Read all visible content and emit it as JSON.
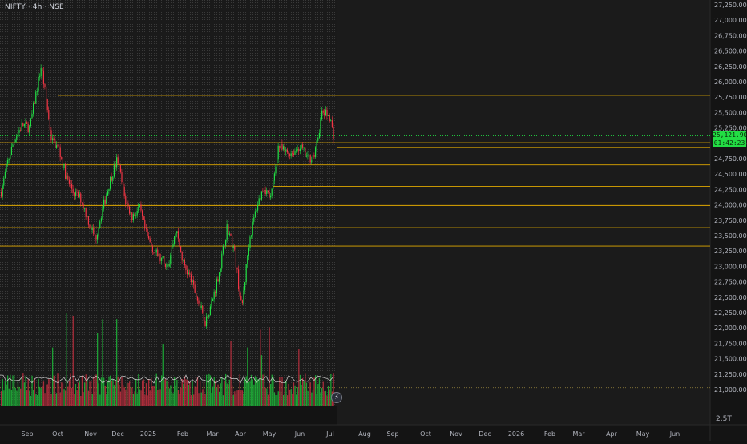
{
  "header": {
    "symbol": "NIFTY",
    "interval": "4h",
    "exchange": "NSE",
    "title": "NIFTY · 4h · NSE"
  },
  "price_axis": {
    "labels": [
      "27,250.00",
      "27,000.00",
      "26,750.00",
      "26,500.00",
      "26,250.00",
      "26,000.00",
      "25,750.00",
      "25,500.00",
      "25,250.00",
      "25,000.00",
      "24,750.00",
      "24,500.00",
      "24,250.00",
      "24,000.00",
      "23,750.00",
      "23,500.00",
      "23,250.00",
      "23,000.00",
      "22,750.00",
      "22,500.00",
      "22,250.00",
      "22,000.00",
      "21,750.00",
      "21,500.00",
      "21,250.00",
      "21,000.00"
    ],
    "volume_label": "2.5T"
  },
  "time_axis": {
    "labels": [
      "Sep",
      "Oct",
      "Nov",
      "Dec",
      "2025",
      "Feb",
      "Mar",
      "Apr",
      "May",
      "Jun",
      "Jul",
      "Aug",
      "Sep",
      "Oct",
      "Nov",
      "Dec",
      "2026",
      "Feb",
      "Mar",
      "Apr",
      "May",
      "Jun"
    ]
  },
  "last_price": {
    "price": "25,121.90",
    "countdown": "01:42:23"
  },
  "colors": {
    "background": "#131313",
    "up": "#22dd44",
    "down": "#f23645",
    "level_line": "#e0a800",
    "text": "#d1d4dc"
  },
  "icons": {
    "replay": "lightning-icon"
  },
  "chart_data": {
    "type": "candlestick",
    "title": "NIFTY · 4h · NSE",
    "x_range": [
      "2024-08-19",
      "2026-06-30"
    ],
    "ylim": [
      20800,
      27400
    ],
    "y_scale": "linear",
    "grid": false,
    "legend": "none",
    "close_path": [
      [
        "2024-08-19",
        24150
      ],
      [
        "2024-08-26",
        24700
      ],
      [
        "2024-09-02",
        25100
      ],
      [
        "2024-09-09",
        25300
      ],
      [
        "2024-09-16",
        25250
      ],
      [
        "2024-09-23",
        25900
      ],
      [
        "2024-09-27",
        26250
      ],
      [
        "2024-10-01",
        25800
      ],
      [
        "2024-10-07",
        25050
      ],
      [
        "2024-10-14",
        24900
      ],
      [
        "2024-10-21",
        24450
      ],
      [
        "2024-10-28",
        24200
      ],
      [
        "2024-11-04",
        24100
      ],
      [
        "2024-11-11",
        23750
      ],
      [
        "2024-11-18",
        23450
      ],
      [
        "2024-11-25",
        23950
      ],
      [
        "2024-12-02",
        24400
      ],
      [
        "2024-12-09",
        24750
      ],
      [
        "2024-12-16",
        24100
      ],
      [
        "2024-12-23",
        23800
      ],
      [
        "2024-12-30",
        23950
      ],
      [
        "2025-01-06",
        23500
      ],
      [
        "2025-01-13",
        23250
      ],
      [
        "2025-01-20",
        23100
      ],
      [
        "2025-01-27",
        23050
      ],
      [
        "2025-02-03",
        23600
      ],
      [
        "2025-02-10",
        23050
      ],
      [
        "2025-02-17",
        22800
      ],
      [
        "2025-02-24",
        22450
      ],
      [
        "2025-03-03",
        22100
      ],
      [
        "2025-03-10",
        22450
      ],
      [
        "2025-03-17",
        22950
      ],
      [
        "2025-03-24",
        23650
      ],
      [
        "2025-03-31",
        23250
      ],
      [
        "2025-04-07",
        22300
      ],
      [
        "2025-04-14",
        23400
      ],
      [
        "2025-04-21",
        23950
      ],
      [
        "2025-04-28",
        24300
      ],
      [
        "2025-05-05",
        24100
      ],
      [
        "2025-05-12",
        24950
      ],
      [
        "2025-05-19",
        24850
      ],
      [
        "2025-05-26",
        24850
      ],
      [
        "2025-06-02",
        24950
      ],
      [
        "2025-06-09",
        24750
      ],
      [
        "2025-06-16",
        24800
      ],
      [
        "2025-06-23",
        25500
      ],
      [
        "2025-06-30",
        25450
      ],
      [
        "2025-07-04",
        25121.9
      ]
    ],
    "horizontal_levels": [
      25850,
      25780,
      25200,
      25010,
      24930,
      24650,
      24300,
      23990,
      23630,
      23330,
      21030
    ],
    "last_price": 25121.9,
    "volume_axis_label": "2.5T"
  }
}
